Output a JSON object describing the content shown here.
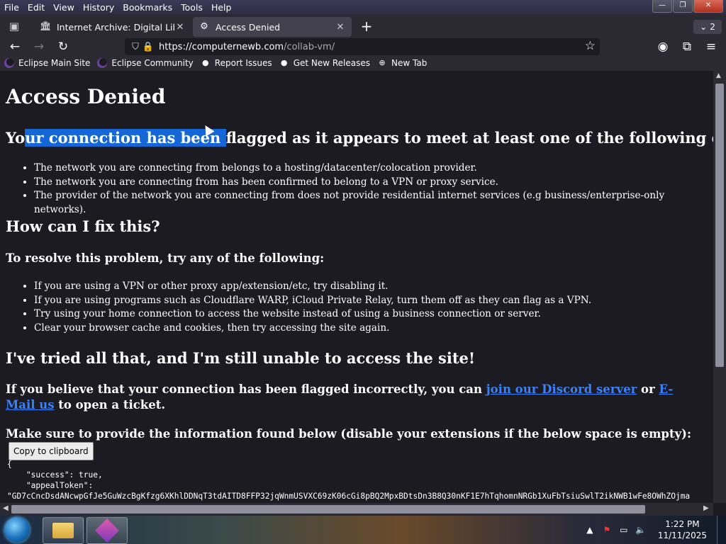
{
  "menu": [
    "File",
    "Edit",
    "View",
    "History",
    "Bookmarks",
    "Tools",
    "Help"
  ],
  "window_buttons": {
    "minimize": "—",
    "restore": "❐",
    "close": "✕"
  },
  "tabs": [
    {
      "title": "Internet Archive: Digital Library",
      "icon": "archive-icon"
    },
    {
      "title": "Access Denied",
      "icon": "page-icon"
    }
  ],
  "tab_count": "2",
  "url": {
    "host": "https://computernewb.com",
    "path": "/collab-vm/"
  },
  "bookmarks": [
    {
      "label": "Eclipse Main Site",
      "icon": "eclipse-icon"
    },
    {
      "label": "Eclipse Community",
      "icon": "eclipse-icon"
    },
    {
      "label": "Report Issues",
      "icon": "github-icon"
    },
    {
      "label": "Get New Releases",
      "icon": "github-icon"
    },
    {
      "label": "New Tab",
      "icon": "globe-icon"
    }
  ],
  "page": {
    "title": "Access Denied",
    "flag_heading": {
      "pre": "Yo",
      "selected": "ur connection has been ",
      "post": "flagged as it appears to meet at least one of the following criteria:"
    },
    "criteria": [
      "The network you are connecting from belongs to a hosting/datacenter/colocation provider.",
      "The network you are connecting from has been confirmed to belong to a VPN or proxy service.",
      "The provider of the network you are connecting from does not provide residential internet services (e.g business/enterprise-only networks)."
    ],
    "fix_heading": "How can I fix this?",
    "resolve_intro": "To resolve this problem, try any of the following:",
    "fixes": [
      "If you are using a VPN or other proxy app/extension/etc, try disabling it.",
      "If you are using programs such as Cloudflare WARP, iCloud Private Relay, turn them off as they can flag as a VPN.",
      "Try using your home connection to access the website instead of using a business connection or server.",
      "Clear your browser cache and cookies, then try accessing the site again."
    ],
    "tried_heading": "I've tried all that, and I'm still unable to access the site!",
    "incorrect": {
      "pre": "If you believe that your connection has been flagged incorrectly, you can ",
      "discord_link": "join our Discord server",
      "mid": " or ",
      "email_link": "E-Mail us",
      "post": " to open a ticket."
    },
    "provide_info": "Make sure to provide the information found below (disable your extensions if the below space is empty):",
    "copy_button": "Copy to clipboard",
    "json_lines": [
      "{",
      "    \"success\": true,",
      "    \"appealToken\":",
      "\"GD7cCncDsdANcwpGfJe5GuWzcBgKfzg6XKhlDDNqT3tdAITD8FFP32jqWnmUSVXC69zK06cGi8pBQ2MpxBDtsDn3B8Q30nKF1E7hTqhomnNRGb1XuFbTsiuSwlT2ikNWB1wFe8OWhZOjma"
    ]
  },
  "taskbar": {
    "time": "1:22 PM",
    "date": "11/11/2025"
  }
}
